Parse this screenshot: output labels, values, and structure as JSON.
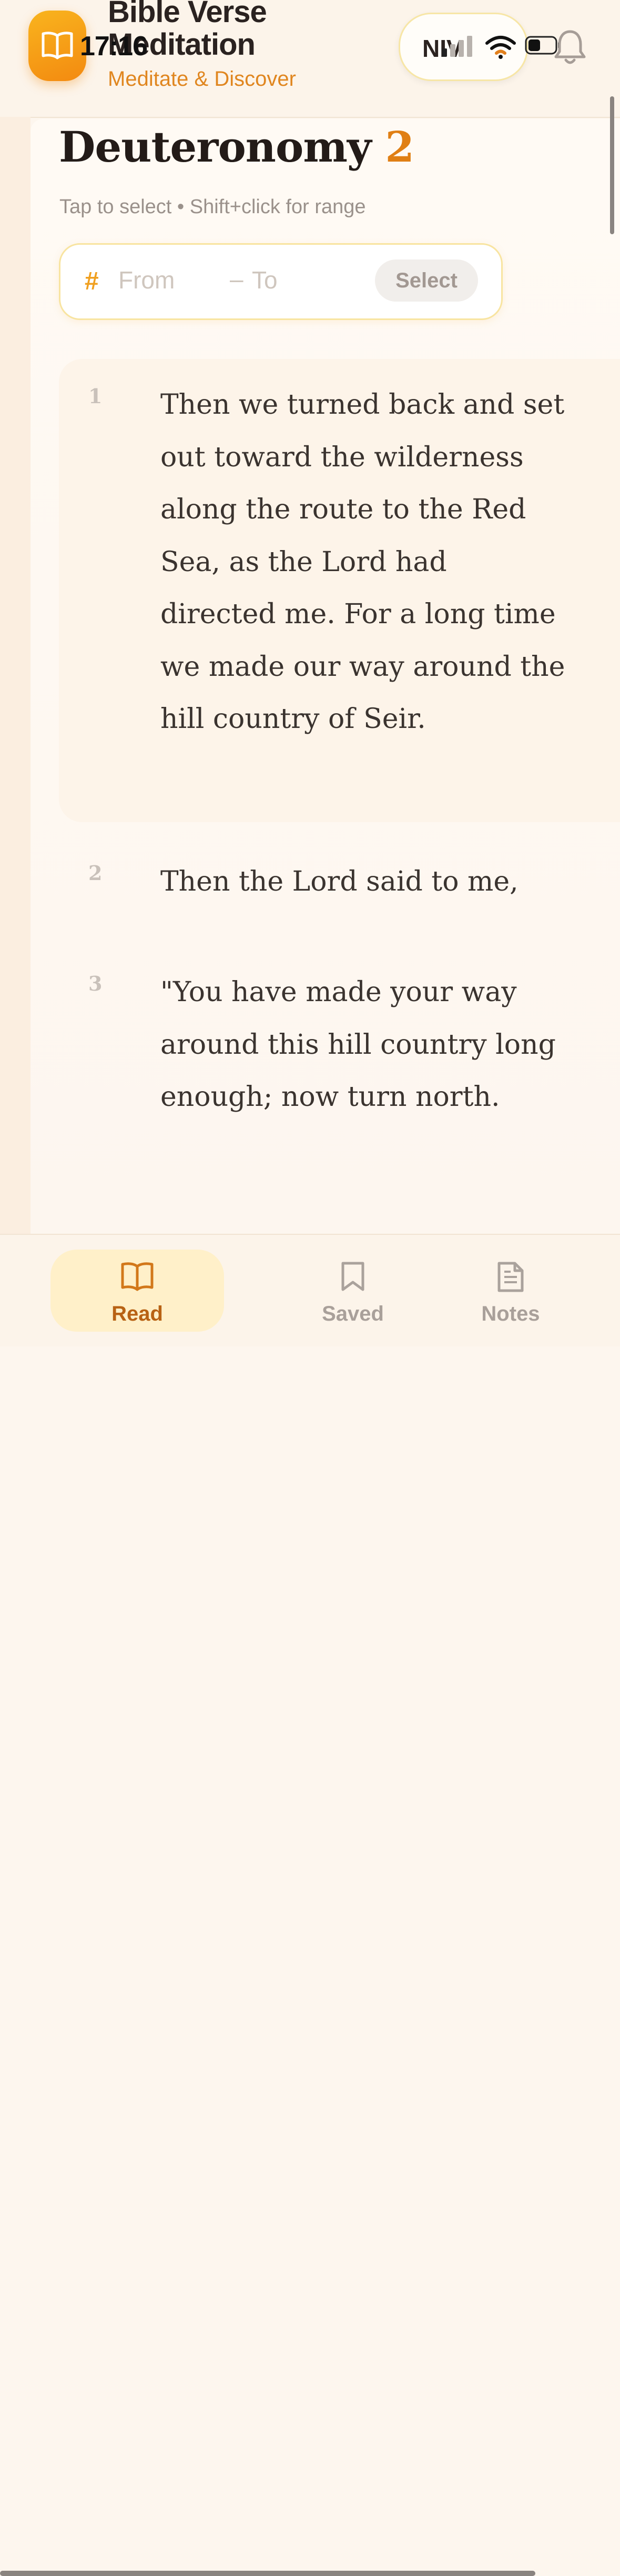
{
  "status_bar": {
    "time": "17:16"
  },
  "header": {
    "app_title": "Bible Verse Meditation",
    "app_subtitle": "Meditate & Discover",
    "version": "NIV",
    "logo_icon": "open-book-icon",
    "bell_icon": "bell-icon"
  },
  "chapter": {
    "book": "Deuteronomy",
    "number": "2",
    "hint": "Tap to select • Shift+click for range"
  },
  "range_selector": {
    "hash": "#",
    "from_placeholder": "From",
    "dash": "–",
    "to_placeholder": "To",
    "select_label": "Select"
  },
  "verses": [
    {
      "number": "1",
      "text": "Then we turned back and set out toward the wilderness along the route to the Red Sea, as the Lord had directed me. For a long time we made our way around the hill country of Seir."
    },
    {
      "number": "2",
      "text": "Then the Lord said to me,"
    },
    {
      "number": "3",
      "text": "\"You have made your way around this hill country long enough; now turn north."
    }
  ],
  "tabbar": {
    "tabs": [
      {
        "label": "Read",
        "icon": "open-book-icon",
        "active": true
      },
      {
        "label": "Saved",
        "icon": "bookmark-icon",
        "active": false
      },
      {
        "label": "Notes",
        "icon": "document-icon",
        "active": false
      }
    ]
  },
  "colors": {
    "accent": "#e07f14",
    "logo_gradient_start": "#f9b41e",
    "logo_gradient_end": "#f38a10",
    "active_tab_bg": "#fff0c9",
    "background": "#fdf6ee"
  }
}
